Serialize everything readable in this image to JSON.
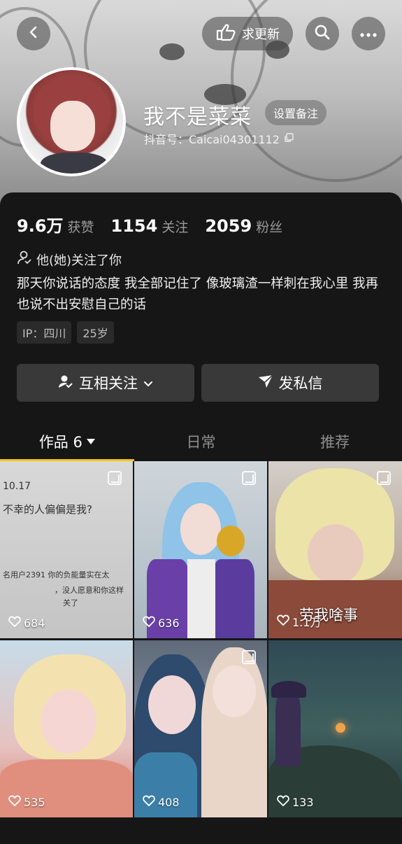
{
  "header": {
    "update_label": "求更新"
  },
  "profile": {
    "nickname": "我不是菜菜",
    "remark_label": "设置备注",
    "douyin_id_label": "抖音号：Caicai04301112"
  },
  "stats": {
    "likes_num": "9.6万",
    "likes_label": "获赞",
    "following_num": "1154",
    "following_label": "关注",
    "followers_num": "2059",
    "followers_label": "粉丝"
  },
  "follows_you_text": "他(她)关注了你",
  "bio": "那天你说话的态度 我全部记住了 像玻璃渣一样刺在我心里 我再也说不出安慰自己的话",
  "tags": [
    "IP：四川",
    "25岁"
  ],
  "actions": {
    "mutual_label": "互相关注",
    "message_label": "发私信"
  },
  "tabs": {
    "works_label": "作品 6",
    "daily_label": "日常",
    "recommend_label": "推荐"
  },
  "thumb1_text": {
    "line1": "10.17",
    "line2": "不幸的人偏偏是我?",
    "line3": "名用户2391  你的负能量实在太",
    "line4": "，没人愿意和你这样",
    "line5": "关了"
  },
  "thumb3_caption": "劳我啥事",
  "videos": [
    {
      "likes": "684"
    },
    {
      "likes": "636"
    },
    {
      "likes": "1.1万"
    },
    {
      "likes": "535"
    },
    {
      "likes": "408"
    },
    {
      "likes": "133"
    }
  ],
  "colors": {
    "accent_tab_underline": "#f5c518",
    "background": "#161616",
    "button_bg": "#393939"
  }
}
